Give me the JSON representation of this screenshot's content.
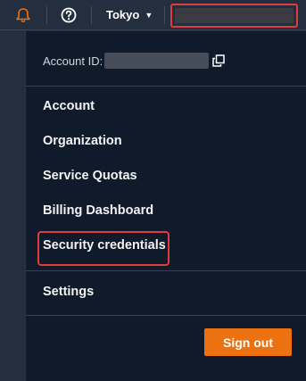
{
  "topbar": {
    "notifications_icon": "bell-icon",
    "help_icon": "question-circle-icon",
    "region": "Tokyo",
    "region_caret_icon": "caret-down-icon"
  },
  "menu": {
    "account_id_label": "Account ID:",
    "copy_icon": "copy-icon",
    "items": [
      "Account",
      "Organization",
      "Service Quotas",
      "Billing Dashboard",
      "Security credentials"
    ],
    "settings": "Settings",
    "signout": "Sign out"
  },
  "colors": {
    "topbar_bg": "#232f3e",
    "menu_bg": "#0f1b2a",
    "accent": "#ec7211",
    "highlight": "#e23b3b"
  }
}
